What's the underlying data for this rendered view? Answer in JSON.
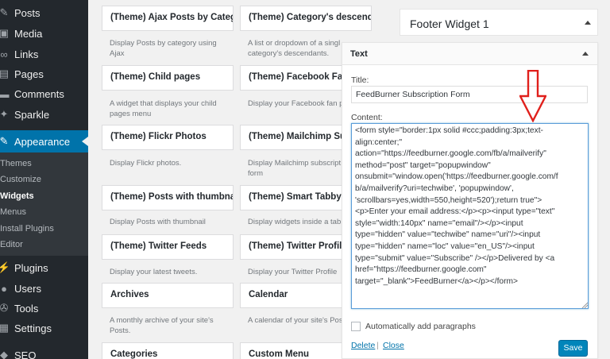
{
  "sidebar": {
    "items": [
      {
        "label": "Posts",
        "icon": "pushpin-icon"
      },
      {
        "label": "Media",
        "icon": "media-icon"
      },
      {
        "label": "Links",
        "icon": "link-icon"
      },
      {
        "label": "Pages",
        "icon": "page-icon"
      },
      {
        "label": "Comments",
        "icon": "comment-icon"
      },
      {
        "label": "Sparkle",
        "icon": "sparkle-icon"
      },
      {
        "label": "Appearance",
        "icon": "brush-icon"
      },
      {
        "label": "Plugins",
        "icon": "plugin-icon"
      },
      {
        "label": "Users",
        "icon": "user-icon"
      },
      {
        "label": "Tools",
        "icon": "wrench-icon"
      },
      {
        "label": "Settings",
        "icon": "settings-icon"
      },
      {
        "label": "SEO",
        "icon": "seo-icon"
      }
    ],
    "submenu": [
      "Themes",
      "Customize",
      "Widgets",
      "Menus",
      "Install Plugins",
      "Editor"
    ]
  },
  "widgets": [
    {
      "title": "(Theme) Ajax Posts by Catego",
      "desc": "Display Posts by category using\nAjax"
    },
    {
      "title": "(Theme) Category's descend",
      "desc": "A list or dropdown of a singl\ncategory's descendants."
    },
    {
      "title": "(Theme) Child pages",
      "desc": "A widget that displays your child\npages menu"
    },
    {
      "title": "(Theme) Facebook Fan pa",
      "desc": "Display your Facebook fan p"
    },
    {
      "title": "(Theme) Flickr Photos",
      "desc": "Display Flickr photos."
    },
    {
      "title": "(Theme) Mailchimp Subscr",
      "desc": "Display Mailchimp subscript\nform"
    },
    {
      "title": "(Theme) Posts with thumbnail",
      "desc": "Display Posts with thumbnail"
    },
    {
      "title": "(Theme) Smart Tabby wid",
      "desc": "Display widgets inside a tab"
    },
    {
      "title": "(Theme) Twitter Feeds",
      "desc": "Display your latest tweets."
    },
    {
      "title": "(Theme) Twitter Profile",
      "desc": "Display your Twitter Profile"
    },
    {
      "title": "Archives",
      "desc": "A monthly archive of your site's\nPosts."
    },
    {
      "title": "Calendar",
      "desc": "A calendar of your site's Pos"
    },
    {
      "title": "Categories",
      "desc": ""
    },
    {
      "title": "Custom Menu",
      "desc": ""
    }
  ],
  "footer_widget": {
    "title": "Footer Widget 1"
  },
  "text_widget": {
    "header": "Text",
    "title_label": "Title:",
    "title_value": "FeedBurner Subscription Form",
    "content_label": "Content:",
    "content_lines": [
      "<form style=\"border:1px solid #ccc;padding:3px;text-",
      "align:center;\"",
      "action=\"https://feedburner.google.com/fb/a/mailverify\"",
      "method=\"post\" target=\"popupwindow\"",
      "onsubmit=\"window.open('https://feedburner.google.com/f",
      "b/a/mailverify?uri=techwibe', 'popupwindow',",
      "'scrollbars=yes,width=550,height=520');return true\">",
      "<p>Enter your email address:</p><p><input type=\"text\"",
      "style=\"width:140px\" name=\"email\"/></p><input",
      "type=\"hidden\" value=\"techwibe\" name=\"uri\"/><input",
      "type=\"hidden\" name=\"loc\" value=\"en_US\"/><input",
      "type=\"submit\" value=\"Subscribe\" /></p>Delivered by <a",
      "href=\"https://feedburner.google.com\"",
      "target=\"_blank\">FeedBurner</a></p></form>"
    ],
    "auto_paragraphs_label": "Automatically add paragraphs",
    "delete_label": "Delete",
    "separator": "|",
    "close_label": "Close",
    "save_label": "Save"
  },
  "colors": {
    "sidebar": "#23282d",
    "active": "#0073aa",
    "arrow": "#e0201c",
    "save": "#0085ba"
  }
}
